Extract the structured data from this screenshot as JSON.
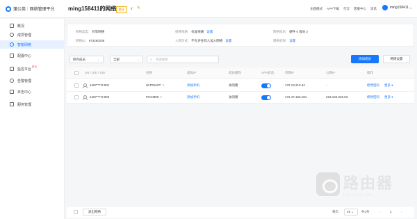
{
  "app": {
    "logo_name": "蒲公英",
    "logo_sub": "网络管理平台"
  },
  "header": {
    "title": "ming158411的网络",
    "badge": "默认",
    "links": [
      "主题模式",
      "APP下载",
      "代写",
      "客服中心",
      "消息"
    ],
    "user_name": "ming158411"
  },
  "sidebar": {
    "items": [
      {
        "label": "概况",
        "icon": "home-icon",
        "active": false,
        "new": ""
      },
      {
        "label": "成员管理",
        "icon": "members-icon",
        "active": false,
        "new": ""
      },
      {
        "label": "智能网络",
        "icon": "network-icon",
        "active": true,
        "new": ""
      },
      {
        "label": "配置中心",
        "icon": "config-icon",
        "active": false,
        "new": ""
      },
      {
        "label": "监控平台",
        "icon": "monitor-icon",
        "active": false,
        "new": "新功"
      },
      {
        "label": "告警管理",
        "icon": "alarm-icon",
        "active": false,
        "new": ""
      },
      {
        "label": "日志中心",
        "icon": "log-icon",
        "active": false,
        "new": ""
      },
      {
        "label": "服务管理",
        "icon": "service-icon",
        "active": false,
        "new": ""
      }
    ]
  },
  "info": {
    "network_type_label": "网络类型:",
    "network_type_value": "对等网络",
    "network_id_label": "网络ID:",
    "network_id_value": "973280208",
    "route_label": "组网线路:",
    "route_value": "标准线路",
    "route_action": "设置",
    "join_label": "入网方式:",
    "join_value": "不允许任何人加入网络",
    "join_action": "设置",
    "members_label": "网络成员:",
    "members_value": "硬件 0  成员 2",
    "permission_label": "网络权限:",
    "permission_action": "设置"
  },
  "toolbar": {
    "member_filter": "所有成员",
    "status_filter": "全部",
    "search_placeholder": "快速搜索",
    "add_button": "添加成员",
    "settings_button": "网络设置"
  },
  "table": {
    "headers": [
      "SN / UID / SID",
      "名称",
      "虚拟IP",
      "成员属性",
      "VPN状态",
      "内网IP",
      "公网IP",
      "操作"
    ],
    "rows": [
      {
        "sn": "1497****2:001",
        "name": "HLTE510T",
        "virtual_ip": "添加手机",
        "attr": "访问者",
        "lan_ip": "172.13.210.44",
        "wan_ip": "-",
        "action_edit": "修改密码",
        "action_more": "更多"
      },
      {
        "sn": "1497****2:002",
        "name": "PCCM00",
        "virtual_ip": "添加手机",
        "attr": "访问者",
        "lan_ip": "172.47.163.194",
        "wan_ip": "223.104.225.53",
        "action_edit": "修改密码",
        "action_more": "更多"
      }
    ]
  },
  "footer": {
    "exit_button": "退出网络",
    "page_label": "每页",
    "page_size": "15",
    "total": "共2条",
    "page": "1"
  },
  "watermark": {
    "title": "路由器",
    "subtitle": "luyouqi.com"
  },
  "colors": {
    "accent": "#1677ff",
    "badge": "#d48806"
  }
}
